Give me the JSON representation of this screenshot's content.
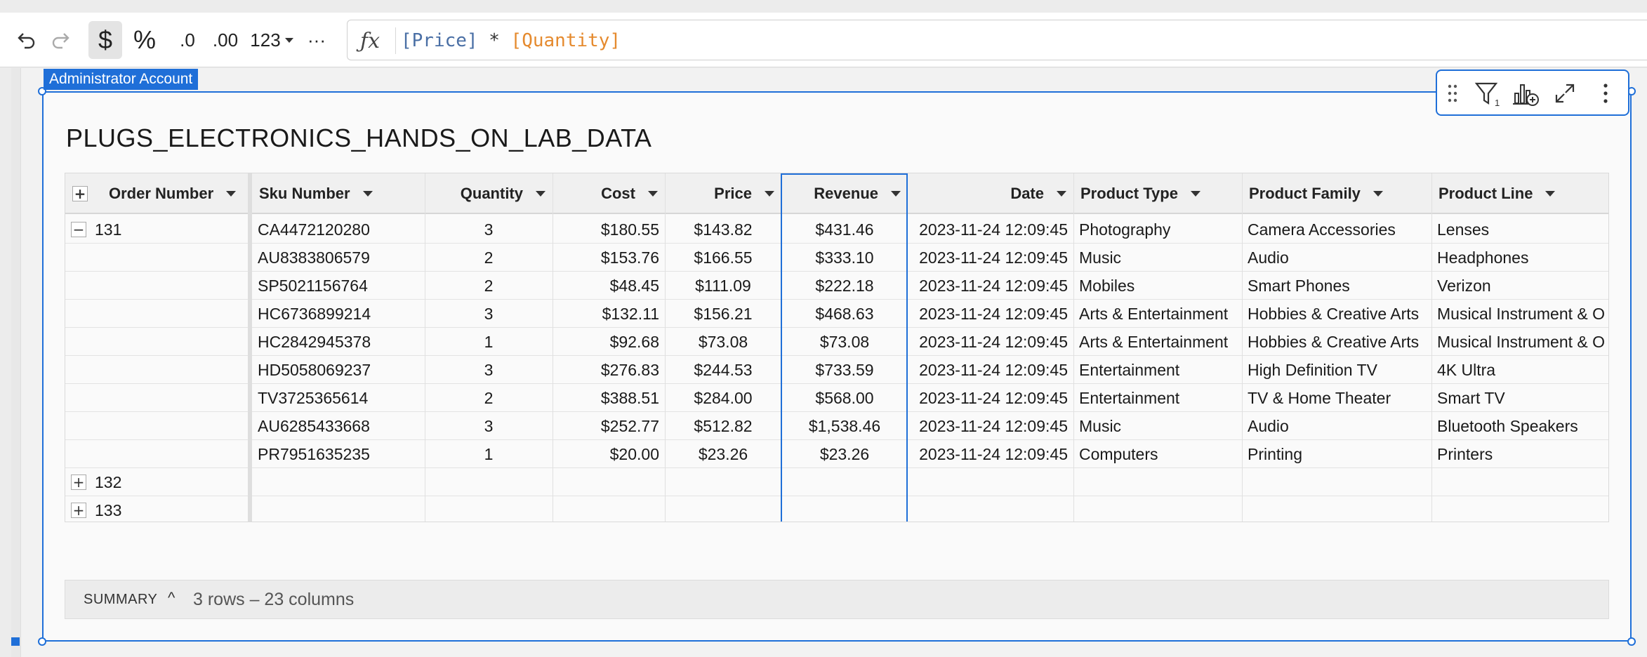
{
  "toolbar": {
    "undo": "undo-icon",
    "redo": "redo-icon",
    "currency": "$",
    "percent": "%",
    "decrease_decimals": ".0",
    "increase_decimals": ".00",
    "number_format": "123",
    "more": "···"
  },
  "formula": {
    "fx": "ƒx",
    "price": "[Price]",
    "op": " * ",
    "quantity": "[Quantity]"
  },
  "card": {
    "owner": "Administrator Account",
    "title": "PLUGS_ELECTRONICS_HANDS_ON_LAB_DATA"
  },
  "colors": {
    "accent": "#1f6fd8",
    "formula_field_price": "#4a6fa5",
    "formula_field_quantity": "#e58a2e"
  },
  "table": {
    "headers": {
      "order_number": "Order Number",
      "sku": "Sku Number",
      "quantity": "Quantity",
      "cost": "Cost",
      "price": "Price",
      "revenue": "Revenue",
      "date": "Date",
      "product_type": "Product Type",
      "product_family": "Product Family",
      "product_line": "Product Line"
    },
    "groups": [
      {
        "order": "131",
        "expanded": "−"
      },
      {
        "order": "132",
        "expanded": "+"
      },
      {
        "order": "133",
        "expanded": "+"
      }
    ],
    "rows": [
      {
        "sku": "CA4472120280",
        "qty": "3",
        "cost": "$180.55",
        "price": "$143.82",
        "revenue": "$431.46",
        "date": "2023-11-24 12:09:45",
        "type": "Photography",
        "family": "Camera Accessories",
        "line": "Lenses"
      },
      {
        "sku": "AU8383806579",
        "qty": "2",
        "cost": "$153.76",
        "price": "$166.55",
        "revenue": "$333.10",
        "date": "2023-11-24 12:09:45",
        "type": "Music",
        "family": "Audio",
        "line": "Headphones"
      },
      {
        "sku": "SP5021156764",
        "qty": "2",
        "cost": "$48.45",
        "price": "$111.09",
        "revenue": "$222.18",
        "date": "2023-11-24 12:09:45",
        "type": "Mobiles",
        "family": "Smart Phones",
        "line": "Verizon"
      },
      {
        "sku": "HC6736899214",
        "qty": "3",
        "cost": "$132.11",
        "price": "$156.21",
        "revenue": "$468.63",
        "date": "2023-11-24 12:09:45",
        "type": "Arts & Entertainment",
        "family": "Hobbies & Creative Arts",
        "line": "Musical Instrument & O"
      },
      {
        "sku": "HC2842945378",
        "qty": "1",
        "cost": "$92.68",
        "price": "$73.08",
        "revenue": "$73.08",
        "date": "2023-11-24 12:09:45",
        "type": "Arts & Entertainment",
        "family": "Hobbies & Creative Arts",
        "line": "Musical Instrument & O"
      },
      {
        "sku": "HD5058069237",
        "qty": "3",
        "cost": "$276.83",
        "price": "$244.53",
        "revenue": "$733.59",
        "date": "2023-11-24 12:09:45",
        "type": "Entertainment",
        "family": "High Definition TV",
        "line": "4K Ultra"
      },
      {
        "sku": "TV3725365614",
        "qty": "2",
        "cost": "$388.51",
        "price": "$284.00",
        "revenue": "$568.00",
        "date": "2023-11-24 12:09:45",
        "type": "Entertainment",
        "family": "TV & Home Theater",
        "line": "Smart TV"
      },
      {
        "sku": "AU6285433668",
        "qty": "3",
        "cost": "$252.77",
        "price": "$512.82",
        "revenue": "$1,538.46",
        "date": "2023-11-24 12:09:45",
        "type": "Music",
        "family": "Audio",
        "line": "Bluetooth Speakers"
      },
      {
        "sku": "PR7951635235",
        "qty": "1",
        "cost": "$20.00",
        "price": "$23.26",
        "revenue": "$23.26",
        "date": "2023-11-24 12:09:45",
        "type": "Computers",
        "family": "Printing",
        "line": "Printers"
      }
    ]
  },
  "summary": {
    "label": "SUMMARY",
    "caret": "^",
    "text": "3 rows – 23 columns"
  }
}
